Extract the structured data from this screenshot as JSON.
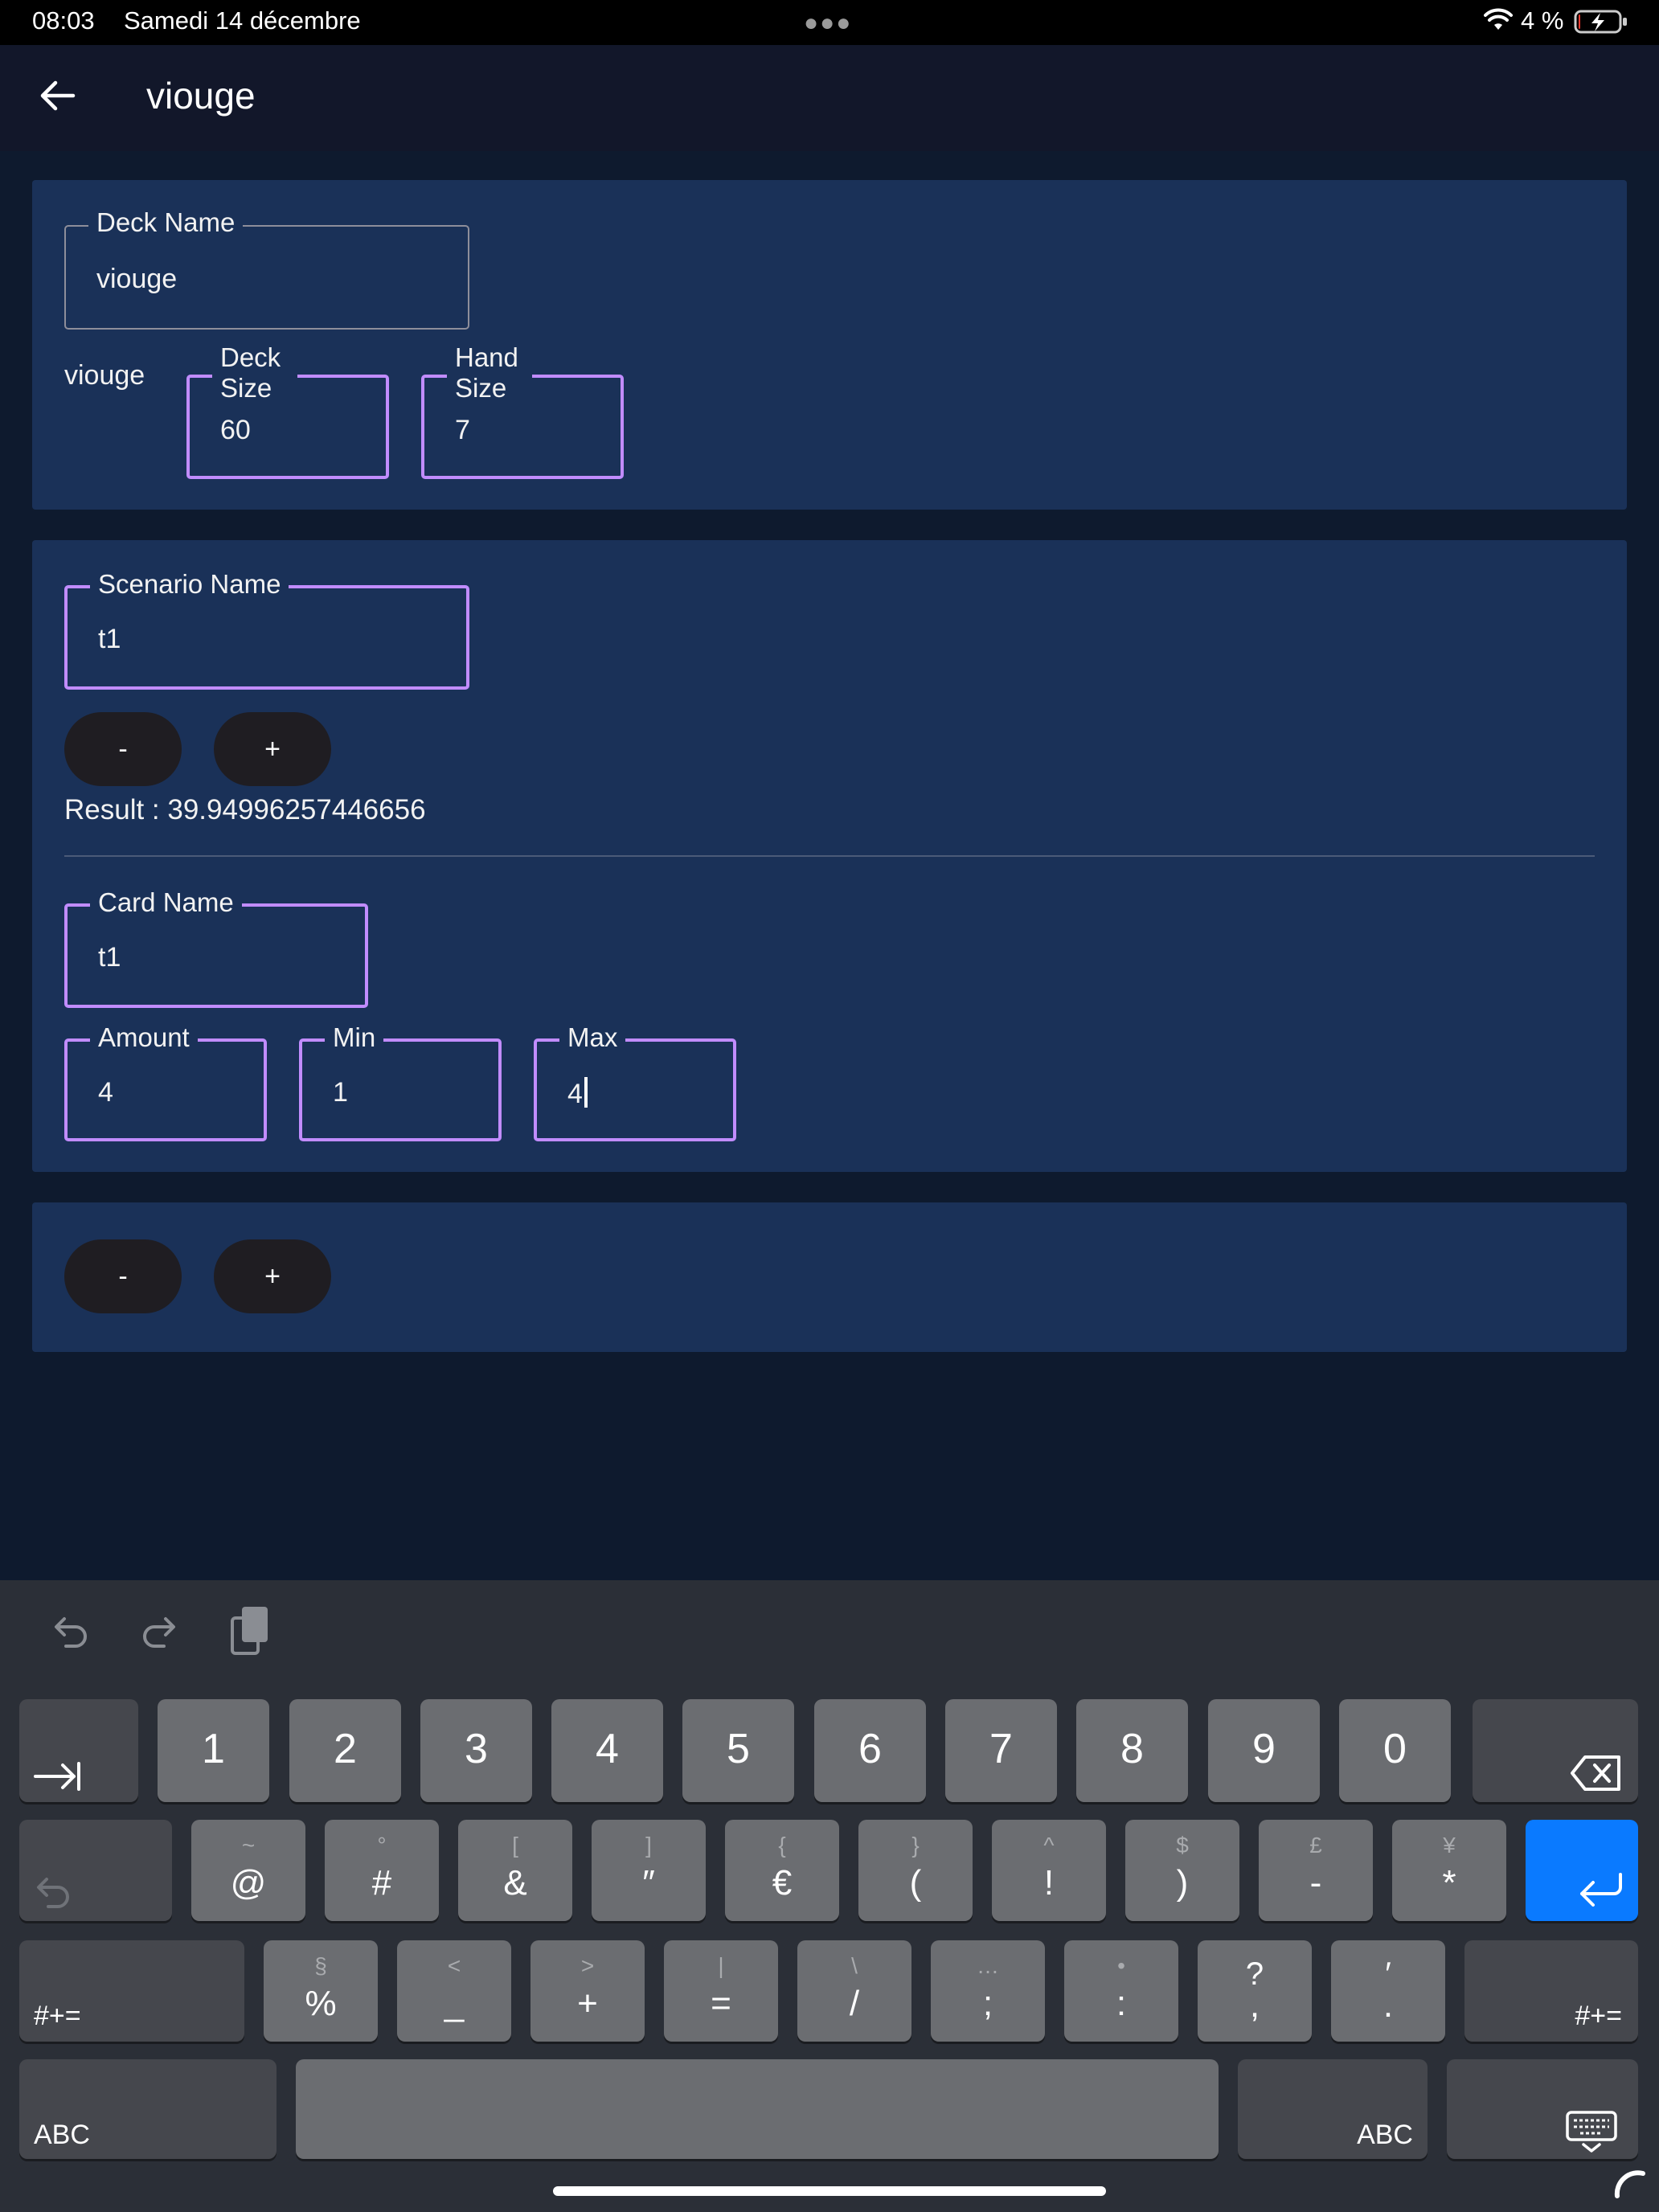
{
  "status_bar": {
    "time": "08:03",
    "date": "Samedi 14 décembre",
    "battery_percent": "4 %",
    "battery_level": 0.04
  },
  "app_bar": {
    "title": "viouge",
    "back_icon": "arrow-left-icon"
  },
  "deck": {
    "name_label": "Deck Name",
    "name_value": "viouge",
    "display_name": "viouge",
    "size_label": "Deck Size",
    "size_value": "60",
    "hand_label": "Hand Size",
    "hand_value": "7"
  },
  "scenario": {
    "name_label": "Scenario Name",
    "name_value": "t1",
    "minus_label": "-",
    "plus_label": "+",
    "result_text": "Result : 39.94996257446656",
    "card": {
      "name_label": "Card Name",
      "name_value": "t1",
      "amount_label": "Amount",
      "amount_value": "4",
      "min_label": "Min",
      "min_value": "1",
      "max_label": "Max",
      "max_value": "4"
    }
  },
  "bottom_controls": {
    "minus_label": "-",
    "plus_label": "+"
  },
  "keyboard": {
    "row1": [
      "1",
      "2",
      "3",
      "4",
      "5",
      "6",
      "7",
      "8",
      "9",
      "0"
    ],
    "row2": [
      {
        "main": "@",
        "sub": "~"
      },
      {
        "main": "#",
        "sub": "°"
      },
      {
        "main": "&",
        "sub": "["
      },
      {
        "main": "″",
        "sub": "]"
      },
      {
        "main": "€",
        "sub": "{"
      },
      {
        "main": "(",
        "sub": "}"
      },
      {
        "main": "!",
        "sub": "^"
      },
      {
        "main": ")",
        "sub": "$"
      },
      {
        "main": "-",
        "sub": "£"
      },
      {
        "main": "*",
        "sub": "¥"
      }
    ],
    "row3": [
      {
        "main": "%",
        "sub": "§"
      },
      {
        "main": "_",
        "sub": "<"
      },
      {
        "main": "+",
        "sub": ">"
      },
      {
        "main": "=",
        "sub": "|"
      },
      {
        "main": "/",
        "sub": "\\"
      },
      {
        "main": ";",
        "sub": "…"
      },
      {
        "main": ":",
        "sub": "•"
      },
      {
        "main": ",",
        "sub": "?"
      },
      {
        "main": ".",
        "sub": "′"
      }
    ],
    "shift_label": "#+=",
    "abc_label": "ABC",
    "accent_color": "#0a7aff"
  }
}
